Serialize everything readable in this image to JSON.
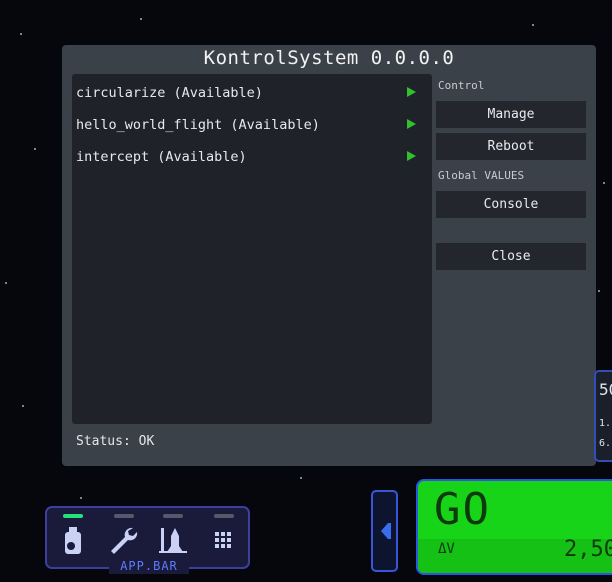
{
  "window": {
    "title": "KontrolSystem 0.0.0.0",
    "scripts": [
      {
        "label": "circularize (Available)"
      },
      {
        "label": "hello_world_flight (Available)"
      },
      {
        "label": "intercept (Available)"
      }
    ],
    "control_label": "Control",
    "manage_label": "Manage",
    "reboot_label": "Reboot",
    "global_label": "Global VALUES",
    "console_label": "Console",
    "close_label": "Close",
    "status": "Status: OK"
  },
  "app_bar": {
    "label": "APP.BAR",
    "icons": [
      "fuel-tank-icon",
      "wrench-icon",
      "vessel-assembly-icon",
      "grid-icon"
    ],
    "active_index": 0
  },
  "go_panel": {
    "text": "GO",
    "dv_label": "ΔV",
    "dv_value": "2,50"
  },
  "edge_widget": {
    "line1": "50",
    "line2": "1.",
    "line3": "6."
  },
  "colors": {
    "window_bg": "#3b4148",
    "panel_bg": "#1f2329",
    "play_green": "#2fc12f",
    "go_green": "#18d418",
    "appbar_blue": "#3c3f9e",
    "appbar_active": "#26e07a"
  }
}
